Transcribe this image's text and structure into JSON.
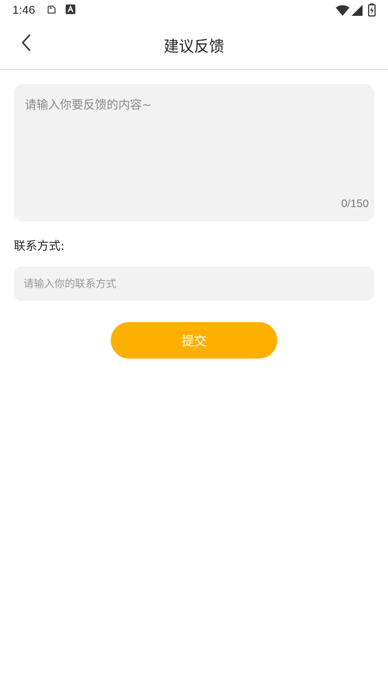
{
  "status_bar": {
    "time": "1:46",
    "icons": [
      "notification-file-icon",
      "notification-a-icon",
      "wifi-icon",
      "signal-icon",
      "battery-charging-icon"
    ]
  },
  "header": {
    "title": "建议反馈",
    "back_icon": "chevron-left-icon"
  },
  "feedback": {
    "placeholder": "请输入你要反馈的内容~",
    "value": "",
    "counter": "0/150"
  },
  "contact": {
    "label": "联系方式:",
    "placeholder": "请输入你的联系方式",
    "value": ""
  },
  "submit": {
    "label": "提交"
  },
  "colors": {
    "accent": "#fdb000",
    "field_bg": "#f2f2f2",
    "divider": "#e7e5dc"
  }
}
